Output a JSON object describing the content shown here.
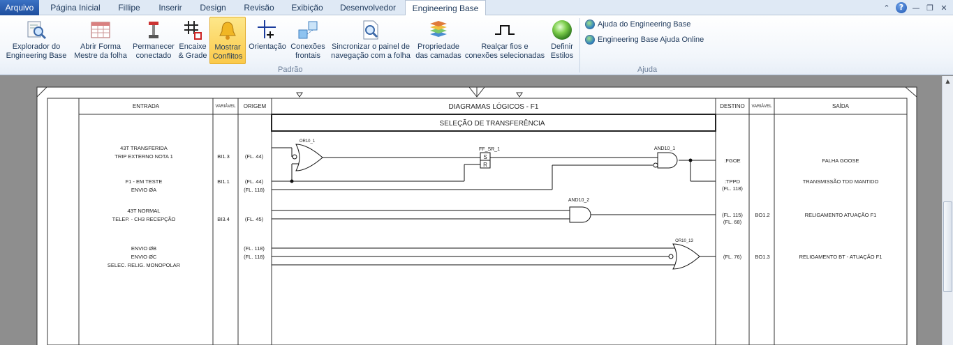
{
  "tabs": {
    "file": "Arquivo",
    "home": "Página Inicial",
    "fillipe": "Fillipe",
    "insert": "Inserir",
    "design": "Design",
    "review": "Revisão",
    "view": "Exibição",
    "developer": "Desenvolvedor",
    "engineering": "Engineering Base"
  },
  "ribbon": {
    "buttons": [
      {
        "l1": "Explorador do",
        "l2": "Engineering Base",
        "icon": "explorer-icon"
      },
      {
        "l1": "Abrir Forma",
        "l2": "Mestre da folha",
        "icon": "master-form-icon"
      },
      {
        "l1": "Permanecer",
        "l2": "conectado",
        "icon": "stay-connected-icon"
      },
      {
        "l1": "Encaixe",
        "l2": "& Grade",
        "icon": "snap-grid-icon"
      },
      {
        "l1": "Mostrar",
        "l2": "Conflitos",
        "icon": "conflicts-bell-icon"
      },
      {
        "l1": "Orientação",
        "l2": "",
        "icon": "orientation-icon"
      },
      {
        "l1": "Conexões",
        "l2": "frontais",
        "icon": "front-connections-icon"
      },
      {
        "l1": "Sincronizar o painel de",
        "l2": "navegação com a folha",
        "icon": "sync-navigation-icon"
      },
      {
        "l1": "Propriedade",
        "l2": "das camadas",
        "icon": "layers-icon"
      },
      {
        "l1": "Realçar fios e",
        "l2": "conexões selecionadas",
        "icon": "highlight-wires-icon"
      },
      {
        "l1": "Definir",
        "l2": "Estilos",
        "icon": "styles-sphere-icon"
      }
    ],
    "group_padrao": "Padrão",
    "group_ajuda": "Ajuda",
    "help1": "Ajuda do Engineering Base",
    "help2": "Engineering Base Ajuda Online"
  },
  "sheet": {
    "hdr_entrada": "ENTRADA",
    "hdr_variavel": "VARIÁVEL",
    "hdr_origem": "ORIGEM",
    "hdr_title": "DIAGRAMAS LÓGICOS - F1",
    "hdr_destino": "DESTINO",
    "hdr_variavel2": "VARIÁVEL",
    "hdr_saida": "SAÍDA",
    "section": "SELEÇÃO DE TRANSFERÊNCIA",
    "in1a": "43T TRANSFERIDA",
    "in1b": "TRIP EXTERNO NOTA 1",
    "var1": "BI1.3",
    "orig1": "(FL. 44)",
    "in2a": "F1 - EM TESTE",
    "in2b": "ENVIO ØA",
    "var2": "BI1.1",
    "orig2a": "(FL. 44)",
    "orig2b": "(FL. 118)",
    "in3a": "43T NORMAL",
    "in3b": "TELEP. - CH3 RECEPÇÃO",
    "var3": "BI3.4",
    "orig3": "(FL. 45)",
    "in4a": "ENVIO ØB",
    "in4b": "ENVIO ØC",
    "in4c": "SELEC. RELIG. MONOPOLAR",
    "orig4a": "(FL. 118)",
    "orig4b": "(FL. 118)",
    "g_or1": "OR10_1",
    "g_ff": "FF_SR_1",
    "g_s": "S",
    "g_r": "R",
    "g_and1": "AND10_1",
    "g_and2": "AND10_2",
    "g_or13": "OR10_13",
    "dest1": ":FGOE",
    "dest2a": ":TPPD",
    "dest2b": "(FL. 118)",
    "dest3a": "(FL. 115)",
    "dest3b": "(FL. 68)",
    "dest4": "(FL. 76)",
    "ovar3": "BO1.2",
    "ovar4": "BO1.3",
    "out1": "FALHA GOOSE",
    "out2": "TRANSMISSÃO TDD MANTIDO",
    "out3": "RELIGAMENTO ATUAÇÃO F1",
    "out4": "RELIGAMENTO BT -  ATUAÇÃO F1"
  }
}
